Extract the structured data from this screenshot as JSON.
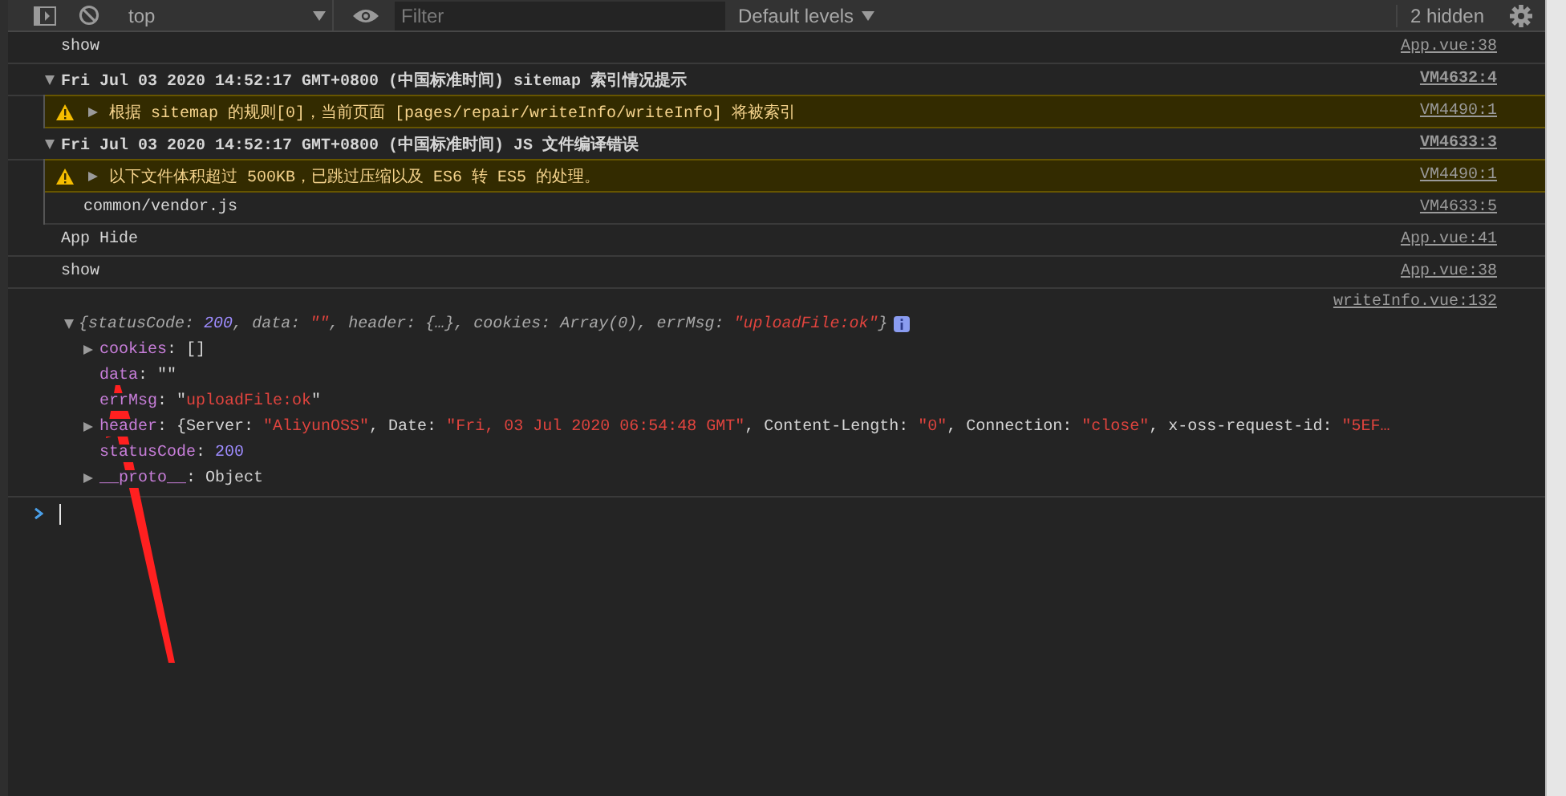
{
  "toolbar": {
    "context": "top",
    "filter": {
      "placeholder": "Filter"
    },
    "levels": "Default levels",
    "hidden": "2 hidden"
  },
  "messages": [
    {
      "kind": "log",
      "text": "show",
      "source": "App.vue:38"
    },
    {
      "kind": "group",
      "expanded": true,
      "text": "Fri Jul 03 2020 14:52:17 GMT+0800 (中国标准时间) sitemap 索引情况提示",
      "source": "VM4632:4",
      "children": [
        {
          "kind": "warning",
          "expanded": false,
          "text": "根据 sitemap 的规则[0]，当前页面 [pages/repair/writeInfo/writeInfo] 将被索引",
          "source": "VM4490:1"
        }
      ]
    },
    {
      "kind": "group",
      "expanded": true,
      "text": "Fri Jul 03 2020 14:52:17 GMT+0800 (中国标准时间) JS 文件编译错误",
      "source": "VM4633:3",
      "children": [
        {
          "kind": "warning",
          "expanded": false,
          "text": "以下文件体积超过 500KB，已跳过压缩以及 ES6 转 ES5 的处理。",
          "source": "VM4490:1"
        },
        {
          "kind": "log",
          "text": "common/vendor.js",
          "source": "VM4633:5"
        }
      ]
    },
    {
      "kind": "log",
      "text": "App Hide",
      "source": "App.vue:41"
    },
    {
      "kind": "log",
      "text": "show",
      "source": "App.vue:38"
    },
    {
      "kind": "object",
      "expanded": true,
      "source": "writeInfo.vue:132",
      "summary": [
        {
          "text": "{",
          "kind": "plain"
        },
        {
          "text": "statusCode: ",
          "kind": "key"
        },
        {
          "text": "200",
          "kind": "number"
        },
        {
          "text": ", ",
          "kind": "plain"
        },
        {
          "text": "data: ",
          "kind": "key"
        },
        {
          "text": "\"\"",
          "kind": "string"
        },
        {
          "text": ", ",
          "kind": "plain"
        },
        {
          "text": "header: ",
          "kind": "key"
        },
        {
          "text": "{…}",
          "kind": "plain"
        },
        {
          "text": ", ",
          "kind": "plain"
        },
        {
          "text": "cookies: ",
          "kind": "key"
        },
        {
          "text": "Array(0)",
          "kind": "plain"
        },
        {
          "text": ", ",
          "kind": "plain"
        },
        {
          "text": "errMsg: ",
          "kind": "key"
        },
        {
          "text": "\"uploadFile:ok\"",
          "kind": "string"
        },
        {
          "text": "}",
          "kind": "plain"
        }
      ],
      "properties": [
        {
          "expandable": true,
          "tokens": [
            {
              "text": "cookies",
              "kind": "key"
            },
            {
              "text": ": []",
              "kind": "plain"
            }
          ]
        },
        {
          "expandable": false,
          "tokens": [
            {
              "text": "data",
              "kind": "key"
            },
            {
              "text": ": \"\"",
              "kind": "plain"
            }
          ]
        },
        {
          "expandable": false,
          "tokens": [
            {
              "text": "errMsg",
              "kind": "key"
            },
            {
              "text": ": \"",
              "kind": "plain"
            },
            {
              "text": "uploadFile:ok",
              "kind": "string"
            },
            {
              "text": "\"",
              "kind": "plain"
            }
          ]
        },
        {
          "expandable": true,
          "tokens": [
            {
              "text": "header",
              "kind": "key"
            },
            {
              "text": ": {Server: ",
              "kind": "plain"
            },
            {
              "text": "\"AliyunOSS\"",
              "kind": "string"
            },
            {
              "text": ", Date: ",
              "kind": "plain"
            },
            {
              "text": "\"Fri, 03 Jul 2020 06:54:48 GMT\"",
              "kind": "string"
            },
            {
              "text": ", Content-Length: ",
              "kind": "plain"
            },
            {
              "text": "\"0\"",
              "kind": "string"
            },
            {
              "text": ", Connection: ",
              "kind": "plain"
            },
            {
              "text": "\"close\"",
              "kind": "string"
            },
            {
              "text": ", x-oss-request-id: ",
              "kind": "plain"
            },
            {
              "text": "\"5EF…",
              "kind": "string"
            }
          ]
        },
        {
          "expandable": false,
          "tokens": [
            {
              "text": "statusCode",
              "kind": "key"
            },
            {
              "text": ": ",
              "kind": "plain"
            },
            {
              "text": "200",
              "kind": "number"
            }
          ]
        },
        {
          "expandable": true,
          "tokens": [
            {
              "text": "__proto__",
              "kind": "key"
            },
            {
              "text": ": Object",
              "kind": "plain"
            }
          ]
        }
      ]
    }
  ]
}
